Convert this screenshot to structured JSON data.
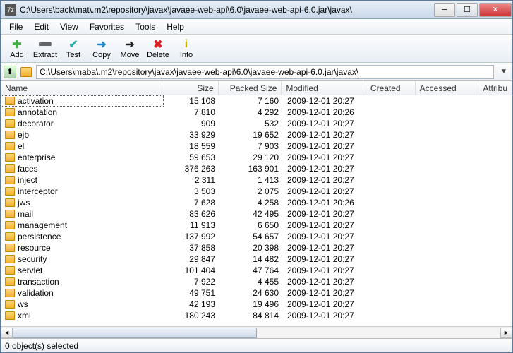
{
  "window": {
    "title": "C:\\Users\\back\\mat\\.m2\\repository\\javax\\javaee-web-api\\6.0\\javaee-web-api-6.0.jar\\javax\\",
    "app_icon": "7z"
  },
  "menu": {
    "file": "File",
    "edit": "Edit",
    "view": "View",
    "favorites": "Favorites",
    "tools": "Tools",
    "help": "Help"
  },
  "toolbar": {
    "add": "Add",
    "extract": "Extract",
    "test": "Test",
    "copy": "Copy",
    "move": "Move",
    "delete": "Delete",
    "info": "Info"
  },
  "path": "C:\\Users\\maba\\.m2\\repository\\javax\\javaee-web-api\\6.0\\javaee-web-api-6.0.jar\\javax\\",
  "columns": {
    "name": "Name",
    "size": "Size",
    "packed": "Packed Size",
    "modified": "Modified",
    "created": "Created",
    "accessed": "Accessed",
    "attributes": "Attribu"
  },
  "rows": [
    {
      "name": "activation",
      "size": "15 108",
      "packed": "7 160",
      "modified": "2009-12-01 20:27",
      "selected": true
    },
    {
      "name": "annotation",
      "size": "7 810",
      "packed": "4 292",
      "modified": "2009-12-01 20:26"
    },
    {
      "name": "decorator",
      "size": "909",
      "packed": "532",
      "modified": "2009-12-01 20:27"
    },
    {
      "name": "ejb",
      "size": "33 929",
      "packed": "19 652",
      "modified": "2009-12-01 20:27"
    },
    {
      "name": "el",
      "size": "18 559",
      "packed": "7 903",
      "modified": "2009-12-01 20:27"
    },
    {
      "name": "enterprise",
      "size": "59 653",
      "packed": "29 120",
      "modified": "2009-12-01 20:27"
    },
    {
      "name": "faces",
      "size": "376 263",
      "packed": "163 901",
      "modified": "2009-12-01 20:27"
    },
    {
      "name": "inject",
      "size": "2 311",
      "packed": "1 413",
      "modified": "2009-12-01 20:27"
    },
    {
      "name": "interceptor",
      "size": "3 503",
      "packed": "2 075",
      "modified": "2009-12-01 20:27"
    },
    {
      "name": "jws",
      "size": "7 628",
      "packed": "4 258",
      "modified": "2009-12-01 20:26"
    },
    {
      "name": "mail",
      "size": "83 626",
      "packed": "42 495",
      "modified": "2009-12-01 20:27"
    },
    {
      "name": "management",
      "size": "11 913",
      "packed": "6 650",
      "modified": "2009-12-01 20:27"
    },
    {
      "name": "persistence",
      "size": "137 992",
      "packed": "54 657",
      "modified": "2009-12-01 20:27"
    },
    {
      "name": "resource",
      "size": "37 858",
      "packed": "20 398",
      "modified": "2009-12-01 20:27"
    },
    {
      "name": "security",
      "size": "29 847",
      "packed": "14 482",
      "modified": "2009-12-01 20:27"
    },
    {
      "name": "servlet",
      "size": "101 404",
      "packed": "47 764",
      "modified": "2009-12-01 20:27"
    },
    {
      "name": "transaction",
      "size": "7 922",
      "packed": "4 455",
      "modified": "2009-12-01 20:27"
    },
    {
      "name": "validation",
      "size": "49 751",
      "packed": "24 630",
      "modified": "2009-12-01 20:27"
    },
    {
      "name": "ws",
      "size": "42 193",
      "packed": "19 496",
      "modified": "2009-12-01 20:27"
    },
    {
      "name": "xml",
      "size": "180 243",
      "packed": "84 814",
      "modified": "2009-12-01 20:27"
    }
  ],
  "status": "0 object(s) selected",
  "icons": {
    "add": {
      "glyph": "✚",
      "color": "#4a4"
    },
    "extract": {
      "glyph": "➖",
      "color": "#36c"
    },
    "test": {
      "glyph": "✔",
      "color": "#3aa"
    },
    "copy": {
      "glyph": "➜",
      "color": "#28c"
    },
    "move": {
      "glyph": "➜",
      "color": "#222"
    },
    "delete": {
      "glyph": "✖",
      "color": "#d22"
    },
    "info": {
      "glyph": "i",
      "color": "#ca0"
    }
  }
}
